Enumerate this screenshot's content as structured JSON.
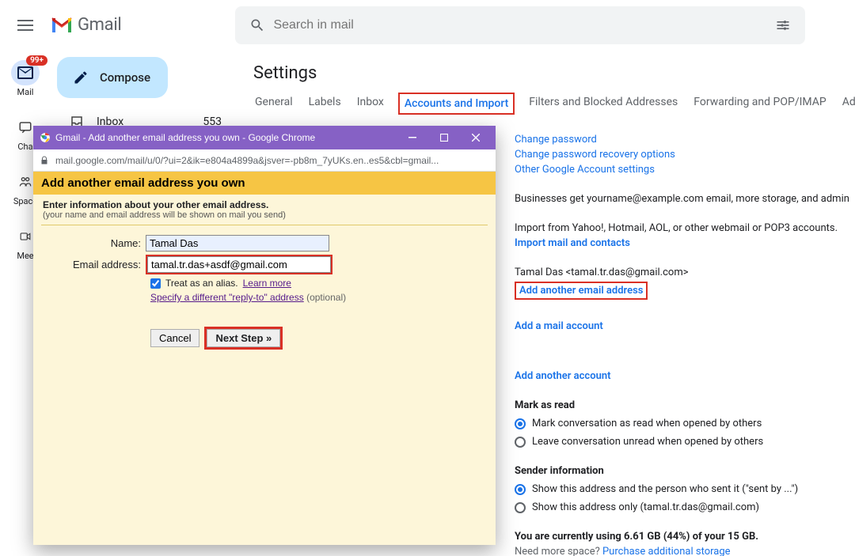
{
  "header": {
    "logo_text": "Gmail",
    "search_placeholder": "Search in mail"
  },
  "rail": {
    "items": [
      {
        "label": "Mail",
        "badge": "99+",
        "icon": "mail"
      },
      {
        "label": "Cha",
        "icon": "chat"
      },
      {
        "label": "Space",
        "icon": "spaces"
      },
      {
        "label": "Mee",
        "icon": "meet"
      }
    ]
  },
  "sidebar": {
    "compose_label": "Compose",
    "inbox_label": "Inbox",
    "inbox_count": "553"
  },
  "settings": {
    "title": "Settings",
    "tabs": [
      "General",
      "Labels",
      "Inbox",
      "Accounts and Import",
      "Filters and Blocked Addresses",
      "Forwarding and POP/IMAP",
      "Add-ons"
    ],
    "active_tab_index": 3,
    "links": {
      "change_password": "Change password",
      "change_recovery": "Change password recovery options",
      "other_account": "Other Google Account settings"
    },
    "business_text": "Businesses get yourname@example.com email, more storage, and admin",
    "import_text": "Import from Yahoo!, Hotmail, AOL, or other webmail or POP3 accounts.",
    "import_link": "Import mail and contacts",
    "user_line": "Tamal Das <tamal.tr.das@gmail.com>",
    "add_another_email": "Add another email address",
    "add_mail_account": "Add a mail account",
    "add_another_account": "Add another account",
    "mark_as_read": {
      "title": "Mark as read",
      "opt1": "Mark conversation as read when opened by others",
      "opt2": "Leave conversation unread when opened by others"
    },
    "sender_info": {
      "title": "Sender information",
      "opt1": "Show this address and the person who sent it (\"sent by ...\")",
      "opt2": "Show this address only (tamal.tr.das@gmail.com)"
    },
    "storage_line": "You are currently using 6.61 GB (44%) of your 15 GB.",
    "storage_sub": "Need more space? ",
    "storage_link": "Purchase additional storage"
  },
  "popup": {
    "window_title": "Gmail - Add another email address you own - Google Chrome",
    "url": "mail.google.com/mail/u/0/?ui=2&ik=e804a4899a&jsver=-pb8m_7yUKs.en..es5&cbl=gmail...",
    "heading": "Add another email address you own",
    "sub_bold": "Enter information about your other email address.",
    "sub_fine": "(your name and email address will be shown on mail you send)",
    "name_label": "Name:",
    "name_value": "Tamal Das",
    "email_label": "Email address:",
    "email_value": "tamal.tr.das+asdf@gmail.com",
    "alias_label": "Treat as an alias.",
    "learn_more": "Learn more",
    "reply_to_link": "Specify a different \"reply-to\" address",
    "reply_to_optional": "(optional)",
    "cancel": "Cancel",
    "next": "Next Step »"
  }
}
